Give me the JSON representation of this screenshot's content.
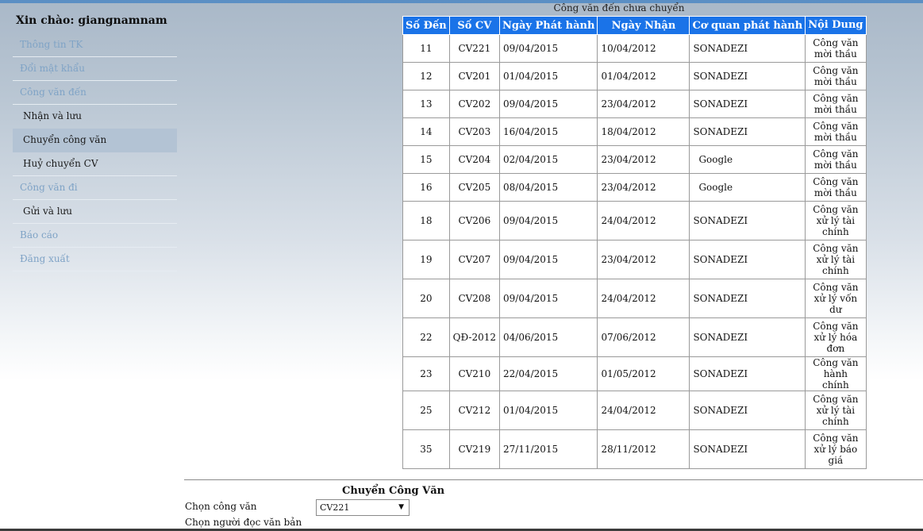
{
  "sidebar": {
    "greeting": "Xin chào: giangnamnam",
    "items": [
      {
        "label": "Thông tin TK"
      },
      {
        "label": "Đổi mật khẩu"
      },
      {
        "label": "Công văn đến"
      },
      {
        "label": "Nhận và lưu"
      },
      {
        "label": "Chuyển công văn"
      },
      {
        "label": "Huỷ chuyển CV"
      },
      {
        "label": "Công văn đi"
      },
      {
        "label": "Gửi và lưu"
      },
      {
        "label": "Báo cáo"
      },
      {
        "label": "Đăng xuất"
      }
    ]
  },
  "table": {
    "title": "Công văn đến chưa chuyển",
    "headers": [
      "Số Đến",
      "Số CV",
      "Ngày Phát hành",
      "Ngày Nhận",
      "Cơ quan phát hành",
      "Nội Dung"
    ],
    "rows": [
      {
        "so_den": "11",
        "so_cv": "CV221",
        "ngay_ph": "09/04/2015",
        "ngay_nhan": "10/04/2012",
        "co_quan": "SONADEZI",
        "noi_dung": "Công văn mời thầu"
      },
      {
        "so_den": "12",
        "so_cv": "CV201",
        "ngay_ph": "01/04/2015",
        "ngay_nhan": "01/04/2012",
        "co_quan": "SONADEZI",
        "noi_dung": "Công văn mời thầu"
      },
      {
        "so_den": "13",
        "so_cv": "CV202",
        "ngay_ph": "09/04/2015",
        "ngay_nhan": "23/04/2012",
        "co_quan": "SONADEZI",
        "noi_dung": "Công văn mời thầu"
      },
      {
        "so_den": "14",
        "so_cv": "CV203",
        "ngay_ph": "16/04/2015",
        "ngay_nhan": "18/04/2012",
        "co_quan": "SONADEZI",
        "noi_dung": "Công văn mời thầu"
      },
      {
        "so_den": "15",
        "so_cv": "CV204",
        "ngay_ph": "02/04/2015",
        "ngay_nhan": "23/04/2012",
        "co_quan": "Google",
        "noi_dung": "Công văn mời thầu"
      },
      {
        "so_den": "16",
        "so_cv": "CV205",
        "ngay_ph": "08/04/2015",
        "ngay_nhan": "23/04/2012",
        "co_quan": "Google",
        "noi_dung": "Công văn mời thầu"
      },
      {
        "so_den": "18",
        "so_cv": "CV206",
        "ngay_ph": "09/04/2015",
        "ngay_nhan": "24/04/2012",
        "co_quan": "SONADEZI",
        "noi_dung": "Công văn xử lý tài chính"
      },
      {
        "so_den": "19",
        "so_cv": "CV207",
        "ngay_ph": "09/04/2015",
        "ngay_nhan": "23/04/2012",
        "co_quan": "SONADEZI",
        "noi_dung": "Công văn xử lý tài chính"
      },
      {
        "so_den": "20",
        "so_cv": "CV208",
        "ngay_ph": "09/04/2015",
        "ngay_nhan": "24/04/2012",
        "co_quan": "SONADEZI",
        "noi_dung": "Công văn xử lý vốn dư"
      },
      {
        "so_den": "22",
        "so_cv": "QĐ-2012",
        "ngay_ph": "04/06/2015",
        "ngay_nhan": "07/06/2012",
        "co_quan": "SONADEZI",
        "noi_dung": "Công văn xử lý hóa đơn"
      },
      {
        "so_den": "23",
        "so_cv": "CV210",
        "ngay_ph": "22/04/2015",
        "ngay_nhan": "01/05/2012",
        "co_quan": "SONADEZI",
        "noi_dung": "Công văn hành chính"
      },
      {
        "so_den": "25",
        "so_cv": "CV212",
        "ngay_ph": "01/04/2015",
        "ngay_nhan": "24/04/2012",
        "co_quan": "SONADEZI",
        "noi_dung": "Công văn xử lý tài chính"
      },
      {
        "so_den": "35",
        "so_cv": "CV219",
        "ngay_ph": "27/11/2015",
        "ngay_nhan": "28/11/2012",
        "co_quan": "SONADEZI",
        "noi_dung": "Công văn xử lý báo giá"
      }
    ]
  },
  "form": {
    "title": "Chuyển Công Văn",
    "label_chon_cv": "Chọn công văn",
    "selected_cv": "CV221",
    "label_chon_nguoi": "Chọn người đọc văn bản"
  },
  "colors": {
    "header_bg": "#1a73e8",
    "sidebar_link": "#7fa3c6",
    "active_bg": "#b3c3d4"
  }
}
